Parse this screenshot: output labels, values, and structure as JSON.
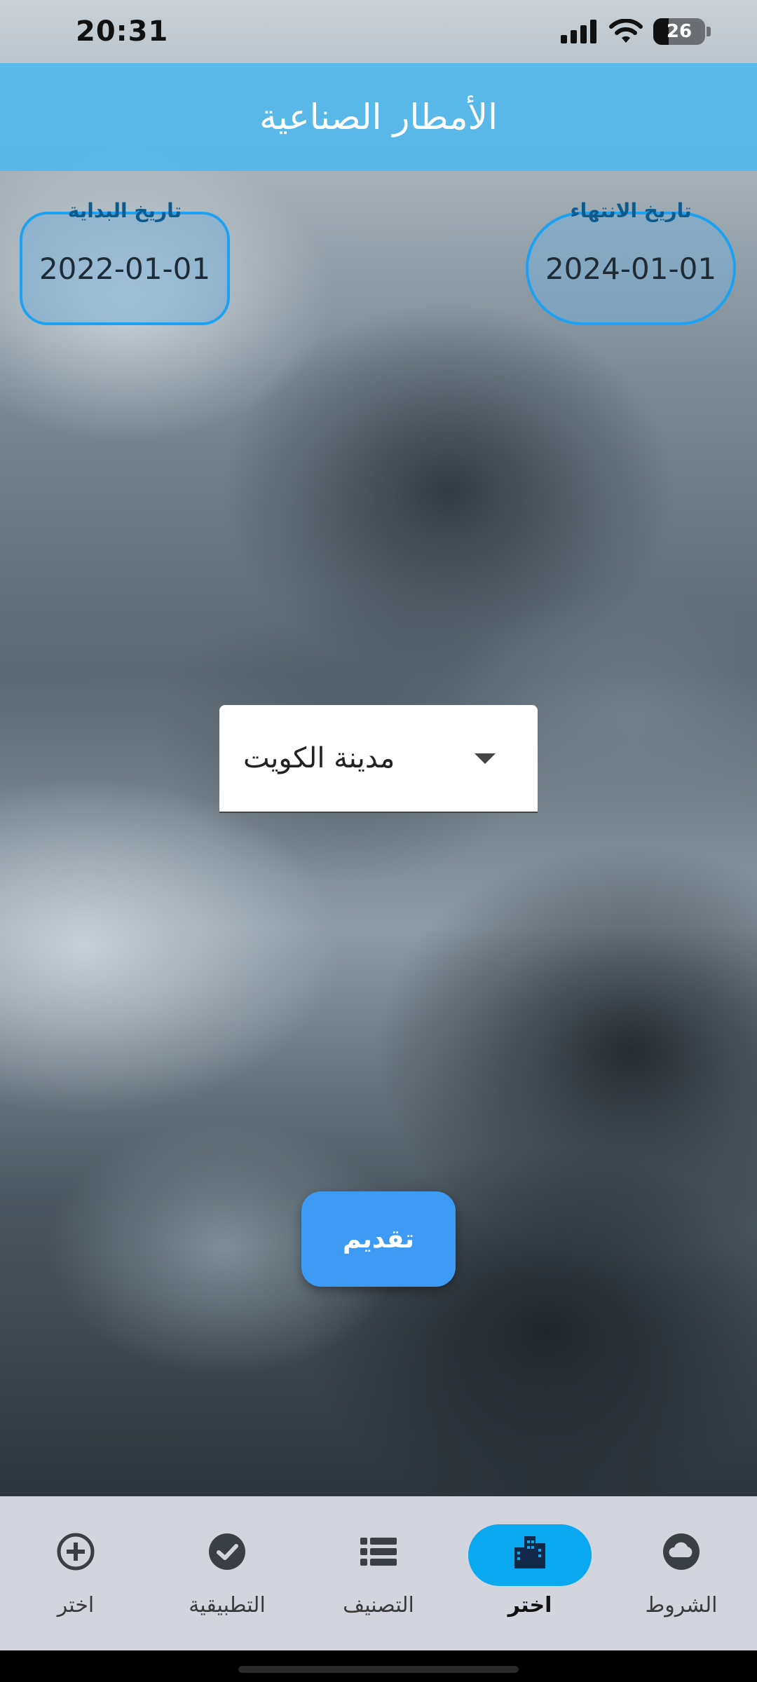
{
  "status_bar": {
    "time": "20:31",
    "battery_level": "26"
  },
  "app_bar": {
    "title": "الأمطار الصناعية"
  },
  "dates": {
    "start_label": "تاريخ البداية",
    "start_value": "2022-01-01",
    "end_label": "تاريخ الانتهاء",
    "end_value": "2024-01-01"
  },
  "city_select": {
    "selected": "مدينة الكويت"
  },
  "submit": {
    "label": "تقديم"
  },
  "nav": {
    "items": [
      {
        "label": "اختر",
        "icon": "plus-circle-icon",
        "active": false
      },
      {
        "label": "التطبيقية",
        "icon": "check-circle-icon",
        "active": false
      },
      {
        "label": "التصنيف",
        "icon": "list-icon",
        "active": false
      },
      {
        "label": "اختر",
        "icon": "city-icon",
        "active": true
      },
      {
        "label": "الشروط",
        "icon": "cloud-icon",
        "active": false
      }
    ]
  },
  "colors": {
    "app_bar": "#52B7EC",
    "accent": "#1DA1F2",
    "submit_button": "#3D9BF6",
    "nav_active_pill": "#0AA8F0",
    "nav_bar": "#D3D5DE"
  }
}
